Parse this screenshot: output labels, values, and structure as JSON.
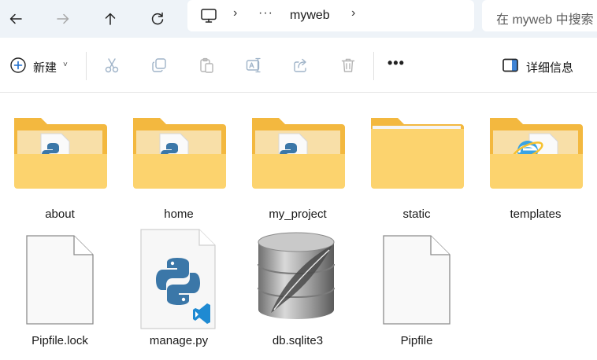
{
  "nav": {
    "back_icon": "arrow-left-icon",
    "forward_icon": "arrow-right-icon",
    "up_icon": "arrow-up-icon",
    "refresh_icon": "refresh-icon"
  },
  "address": {
    "separator": "›",
    "overflow": "···",
    "current_folder": "myweb"
  },
  "search": {
    "placeholder": "在 myweb 中搜索"
  },
  "toolbar": {
    "new_label": "新建",
    "new_caret": "˅",
    "more_label": "•••",
    "details_label": "详细信息"
  },
  "items": [
    {
      "name": "about",
      "type": "folder-python"
    },
    {
      "name": "home",
      "type": "folder-python"
    },
    {
      "name": "my_project",
      "type": "folder-python"
    },
    {
      "name": "static",
      "type": "folder"
    },
    {
      "name": "templates",
      "type": "folder-html"
    },
    {
      "name": "Pipfile.lock",
      "type": "file-blank"
    },
    {
      "name": "manage.py",
      "type": "file-python"
    },
    {
      "name": "db.sqlite3",
      "type": "file-database"
    },
    {
      "name": "Pipfile",
      "type": "file-blank"
    }
  ],
  "colors": {
    "nav_bg": "#eef3f8",
    "folder_back": "#f3b83f",
    "folder_front": "#fcd36e",
    "accent": "#1f6fce"
  }
}
